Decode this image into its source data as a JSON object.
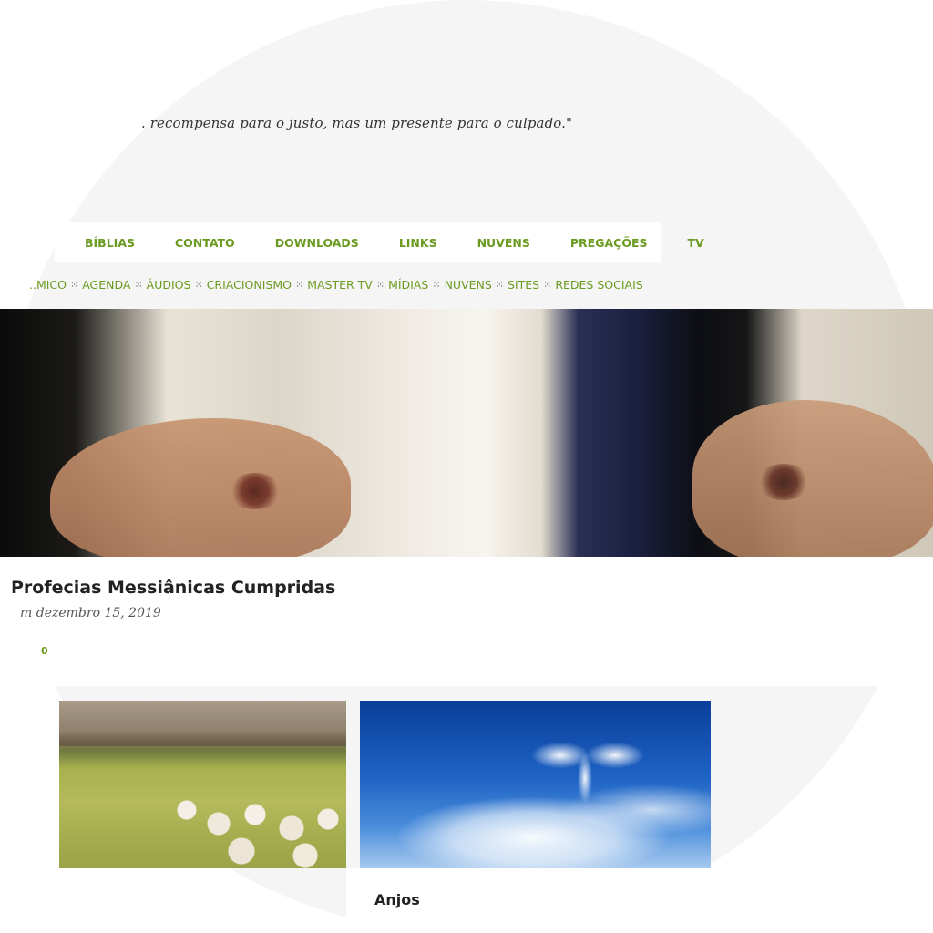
{
  "header": {
    "quote": ". recompensa para o justo, mas um presente para o culpado.\""
  },
  "menu": {
    "items": [
      {
        "label": "BÍBLIAS"
      },
      {
        "label": "CONTATO"
      },
      {
        "label": "DOWNLOADS"
      },
      {
        "label": "LINKS"
      },
      {
        "label": "NUVENS"
      },
      {
        "label": "PREGAÇÕES"
      },
      {
        "label": "TV"
      }
    ]
  },
  "submenu": {
    "items": [
      {
        "label": "..MICO"
      },
      {
        "label": "AGENDA"
      },
      {
        "label": "ÁUDIOS"
      },
      {
        "label": "CRIACIONISMO"
      },
      {
        "label": "MASTER TV"
      },
      {
        "label": "MÍDIAS"
      },
      {
        "label": "NUVENS"
      },
      {
        "label": "SITES"
      },
      {
        "label": "REDES SOCIAIS"
      }
    ],
    "separator": "⁙"
  },
  "post": {
    "title": "Profecias Messiânicas Cumpridas",
    "date": "m dezembro 15, 2019",
    "comment_count": "0"
  },
  "cards": [
    {
      "title": ""
    },
    {
      "title": "Anjos"
    }
  ],
  "colors": {
    "accent": "#6a9a1f",
    "background": "#f5f5f5"
  }
}
